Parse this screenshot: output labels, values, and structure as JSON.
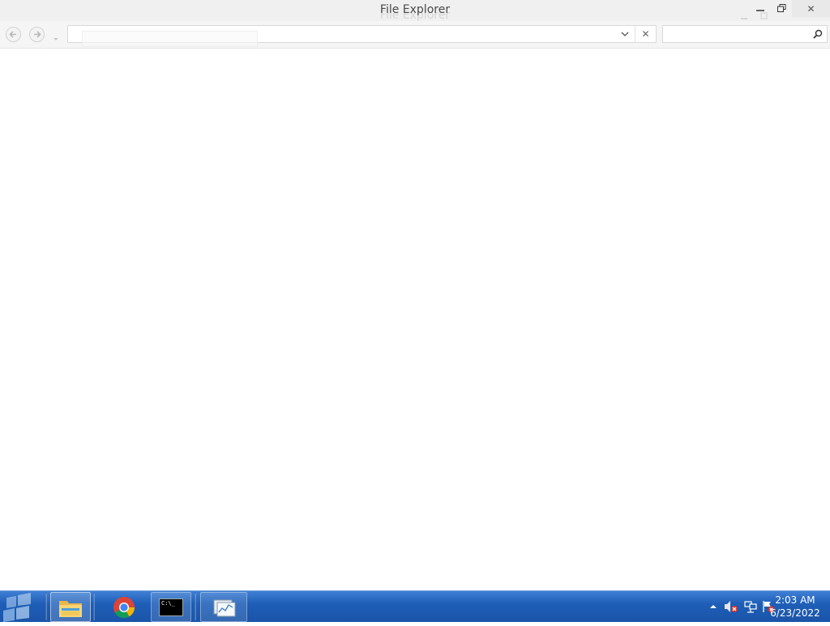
{
  "window": {
    "title": "File Explorer",
    "ghost_title": "File Explorer",
    "close_glyph": "✕",
    "address": {
      "value": "",
      "clear_glyph": "✕"
    },
    "search": {
      "placeholder": ""
    }
  },
  "taskbar": {
    "items": [
      {
        "icon": "file-explorer-icon",
        "active": true
      },
      {
        "icon": "chrome-icon",
        "active": false
      },
      {
        "icon": "command-prompt-icon",
        "active": false,
        "label": "C:\\_"
      },
      {
        "icon": "resource-monitor-icon",
        "active": false
      }
    ],
    "clock": {
      "time": "2:03 AM",
      "date": "6/23/2022"
    },
    "colors": {
      "taskbar_blue": "#1f5fb8"
    }
  }
}
